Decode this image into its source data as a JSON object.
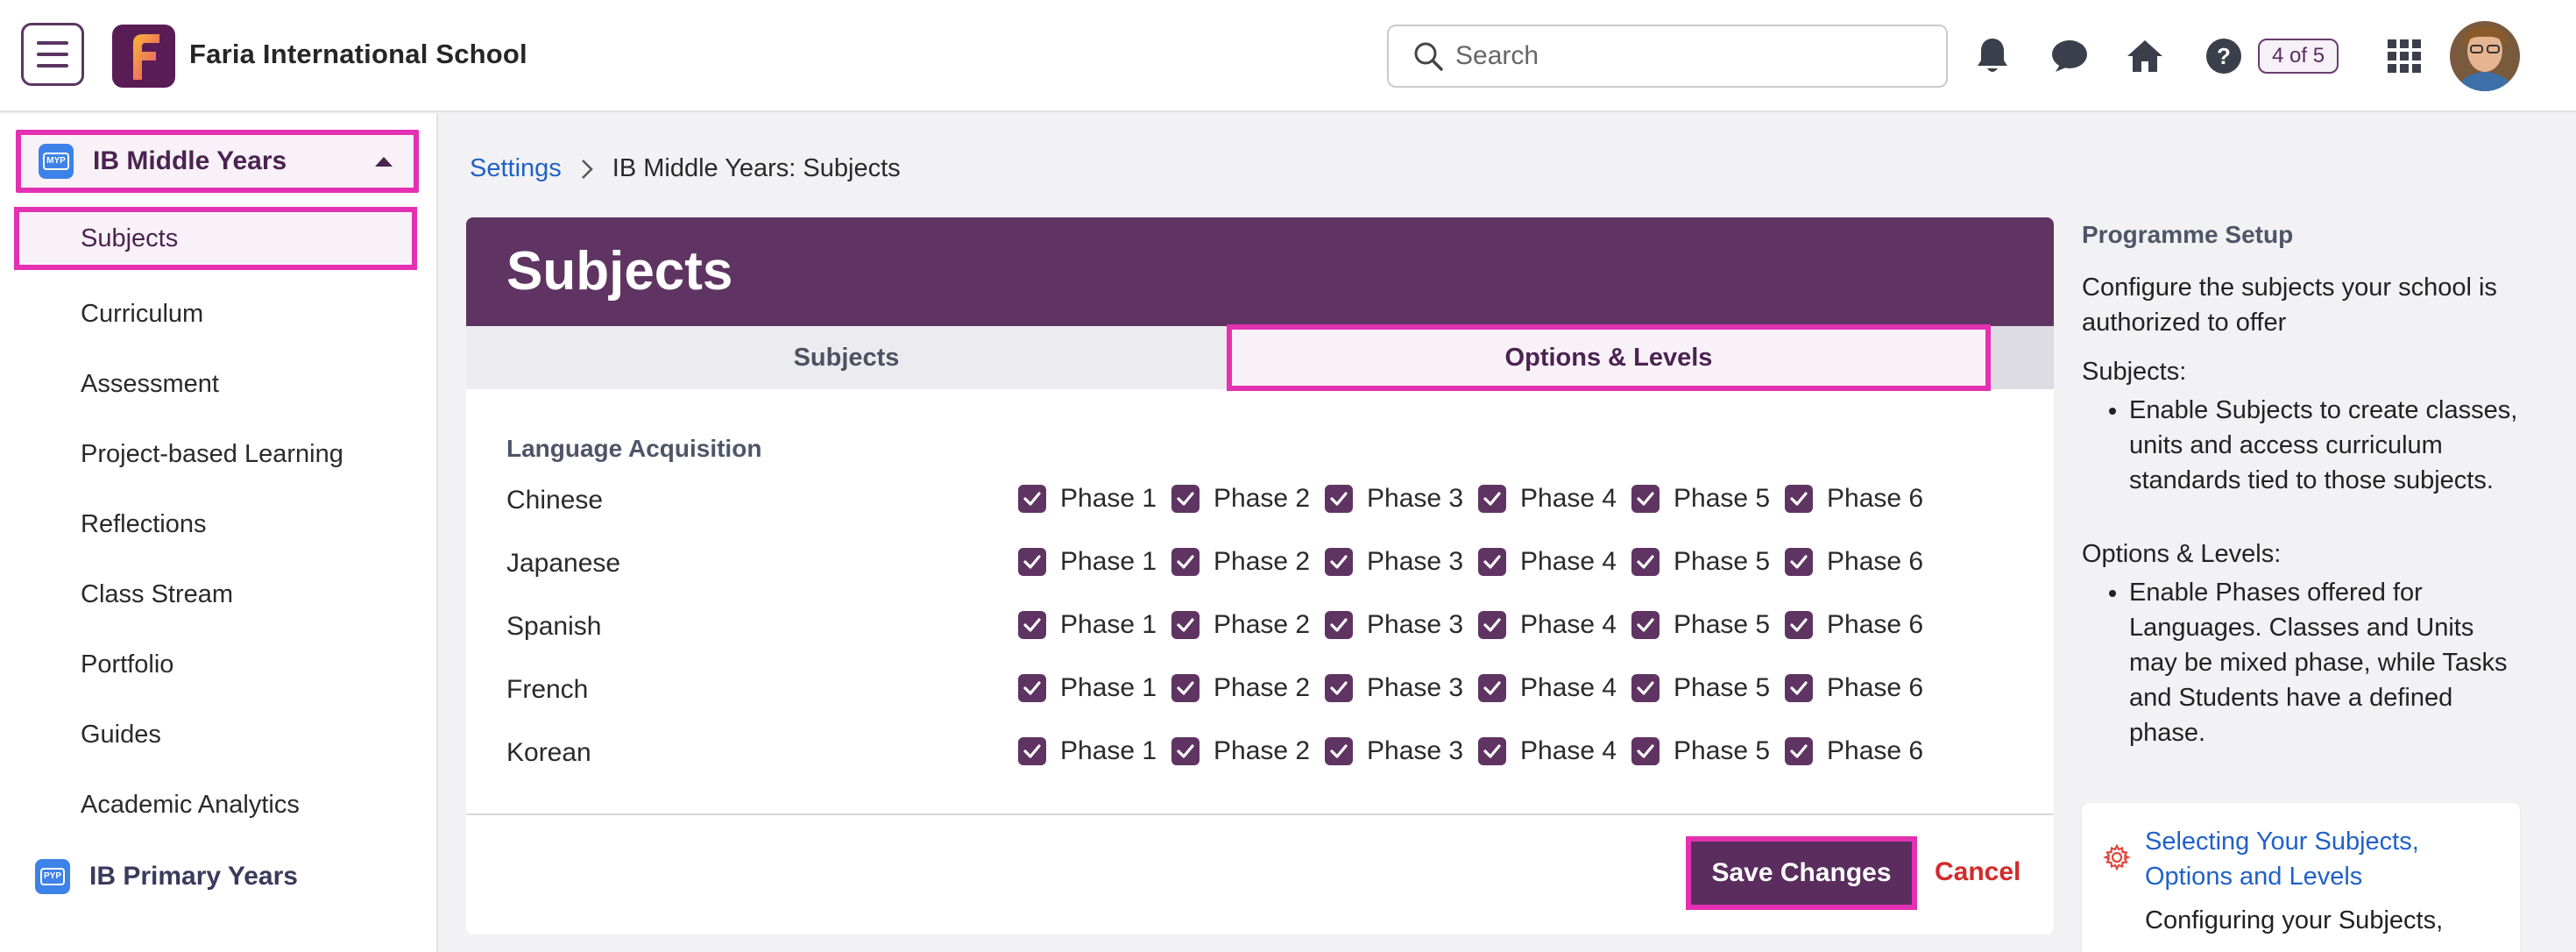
{
  "topbar": {
    "school_name": "Faria International School",
    "search_placeholder": "Search",
    "page_count": "4 of 5",
    "icons": [
      "menu-icon",
      "notification-bell-icon",
      "chat-icon",
      "home-icon",
      "help-icon",
      "apps-grid-icon",
      "user-avatar"
    ]
  },
  "sidebar": {
    "programme": "IB Middle Years",
    "programme_badge": "MYP",
    "selected_item": "Subjects",
    "items": [
      "Curriculum",
      "Assessment",
      "Project-based Learning",
      "Reflections",
      "Class Stream",
      "Portfolio",
      "Guides",
      "Academic Analytics"
    ],
    "programme_2": "IB Primary Years",
    "programme_2_badge": "PYP"
  },
  "breadcrumb": {
    "root": "Settings",
    "current": "IB Middle Years: Subjects"
  },
  "main": {
    "title": "Subjects",
    "tabs": [
      {
        "label": "Subjects",
        "active": false
      },
      {
        "label": "Options & Levels",
        "active": true
      }
    ],
    "section_title": "Language Acquisition",
    "languages": [
      {
        "name": "Chinese",
        "phases": [
          "Phase 1",
          "Phase 2",
          "Phase 3",
          "Phase 4",
          "Phase 5",
          "Phase 6"
        ]
      },
      {
        "name": "Japanese",
        "phases": [
          "Phase 1",
          "Phase 2",
          "Phase 3",
          "Phase 4",
          "Phase 5",
          "Phase 6"
        ]
      },
      {
        "name": "Spanish",
        "phases": [
          "Phase 1",
          "Phase 2",
          "Phase 3",
          "Phase 4",
          "Phase 5",
          "Phase 6"
        ]
      },
      {
        "name": "French",
        "phases": [
          "Phase 1",
          "Phase 2",
          "Phase 3",
          "Phase 4",
          "Phase 5",
          "Phase 6"
        ]
      },
      {
        "name": "Korean",
        "phases": [
          "Phase 1",
          "Phase 2",
          "Phase 3",
          "Phase 4",
          "Phase 5",
          "Phase 6"
        ]
      }
    ],
    "save_label": "Save Changes",
    "cancel_label": "Cancel"
  },
  "right_panel": {
    "title": "Programme Setup",
    "intro": "Configure the subjects your school is authorized to offer",
    "subjects_heading": "Subjects:",
    "subjects_bullet": "Enable Subjects to create classes, units and access curriculum standards tied to those subjects.",
    "options_heading": "Options & Levels:",
    "options_bullet": "Enable Phases offered for Languages. Classes and Units may be mixed phase, while Tasks and Students have a defined phase.",
    "help_link": "Selecting Your Subjects, Options and Levels",
    "help_sub": "Configuring your Subjects,"
  },
  "colors": {
    "brand_purple": "#5f3462",
    "highlight_pink": "#e331b2",
    "link_blue": "#1f61c8",
    "cancel_red": "#d42a2a"
  }
}
